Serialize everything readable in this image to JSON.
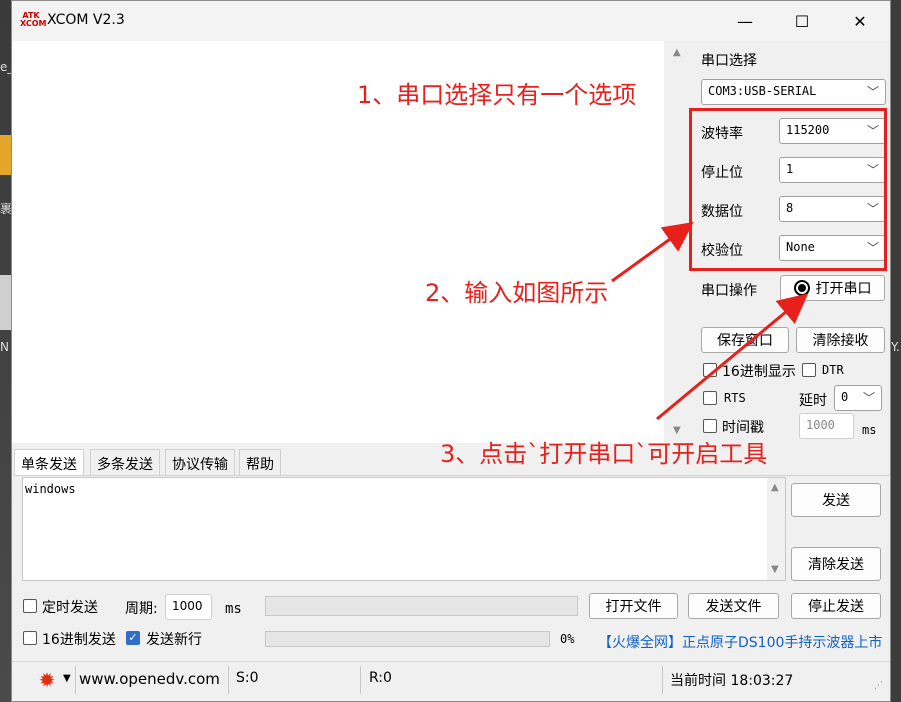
{
  "window": {
    "logo_text": "ATK XCOM",
    "title": "XCOM V2.3",
    "minimize": "—",
    "maximize": "☐",
    "close": "✕"
  },
  "background": {
    "frag1": "e_",
    "frag2": "裹",
    "frag3": "N",
    "frag4": "Y."
  },
  "serial": {
    "port_select_label": "串口选择",
    "port_value": "COM3:USB-SERIAL",
    "baud_label": "波特率",
    "baud_value": "115200",
    "stop_label": "停止位",
    "stop_value": "1",
    "data_label": "数据位",
    "data_value": "8",
    "parity_label": "校验位",
    "parity_value": "None",
    "op_label": "串口操作",
    "open_button": "打开串口",
    "save_window": "保存窗口",
    "clear_recv": "清除接收",
    "hex_display": "16进制显示",
    "dtr": "DTR",
    "rts": "RTS",
    "delay_label": "延时",
    "delay_value": "0",
    "timestamp": "时间戳",
    "timestamp_value": "1000",
    "ms": "ms"
  },
  "tabs": [
    "单条发送",
    "多条发送",
    "协议传输",
    "帮助"
  ],
  "send": {
    "text": "windows",
    "send_button": "发送",
    "clear_send": "清除发送",
    "timed_send": "定时发送",
    "period_label": "周期:",
    "period_value": "1000",
    "ms": "ms",
    "open_file": "打开文件",
    "send_file": "发送文件",
    "stop_send": "停止发送",
    "hex_send": "16进制发送",
    "newline": "发送新行",
    "percent": "0%",
    "ad_text": "【火爆全网】正点原子DS100手持示波器上市"
  },
  "status": {
    "url": "www.openedv.com",
    "sent": "S:0",
    "recv": "R:0",
    "time": "当前时间 18:03:27"
  },
  "annotations": {
    "note1": "1、串口选择只有一个选项",
    "note2": "2、输入如图所示",
    "note3": "3、点击`打开串口`可开启工具"
  },
  "colors": {
    "annotation_red": "#e8201c",
    "checkbox_blue": "#2f6fc8",
    "ad_blue": "#1060c8"
  }
}
